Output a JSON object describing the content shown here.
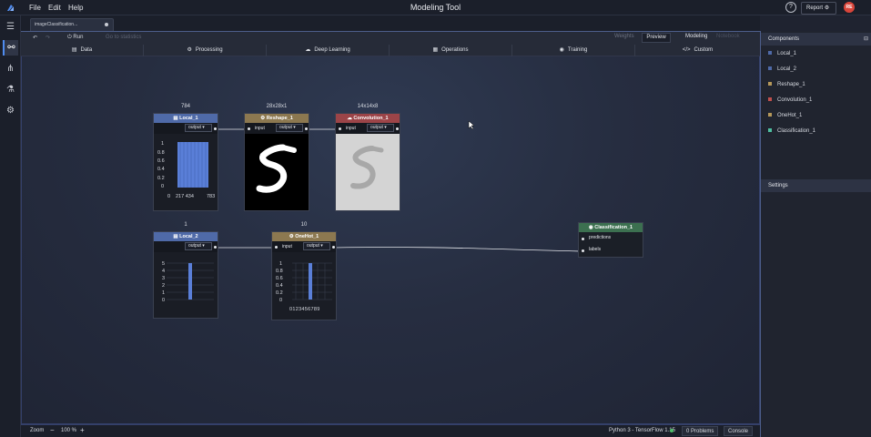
{
  "app": {
    "title": "Modeling Tool"
  },
  "menu": {
    "file": "File",
    "edit": "Edit",
    "help": "Help"
  },
  "header": {
    "help_label": "?",
    "report_label": "Report",
    "avatar_initials": "RE"
  },
  "tab": {
    "name": "imageClassification..."
  },
  "toolbar": {
    "run_label": "Run",
    "go_statistics": "Go to statistics",
    "weights": "Weights",
    "preview": "Preview",
    "modeling": "Modeling",
    "notebook": "Notebook"
  },
  "categories": [
    {
      "label": "Data",
      "icon": "database-icon",
      "color": "#7f8db0"
    },
    {
      "label": "Processing",
      "icon": "gear-icon",
      "color": "#b5985a"
    },
    {
      "label": "Deep Learning",
      "icon": "brain-icon",
      "color": "#b04b52"
    },
    {
      "label": "Operations",
      "icon": "grid-icon",
      "color": "#5a7fd8"
    },
    {
      "label": "Training",
      "icon": "target-icon",
      "color": "#5aa06b"
    },
    {
      "label": "Custom",
      "icon": "code-icon",
      "color": "#8c92a2"
    }
  ],
  "components": {
    "local1": {
      "name": "Local_1",
      "dim": "784",
      "port_out": "output",
      "axis": [
        "1",
        "0.8",
        "0.6",
        "0.4",
        "0.2",
        "0"
      ],
      "xticks": [
        "0",
        "217 434",
        "783"
      ],
      "color": "#4f6aa8"
    },
    "reshape1": {
      "name": "Reshape_1",
      "dim": "28x28x1",
      "port_in": "input",
      "port_out": "output",
      "color": "#8c7850"
    },
    "conv1": {
      "name": "Convolution_1",
      "dim": "14x14x8",
      "port_in": "input",
      "port_out": "output",
      "color": "#9c4448"
    },
    "local2": {
      "name": "Local_2",
      "dim": "1",
      "port_out": "output",
      "axis": [
        "5",
        "4",
        "3",
        "2",
        "1",
        "0"
      ],
      "color": "#4f6aa8",
      "value": 5
    },
    "onehot1": {
      "name": "OneHot_1",
      "dim": "10",
      "port_in": "input",
      "port_out": "output",
      "axis": [
        "1",
        "0.8",
        "0.6",
        "0.4",
        "0.2",
        "0"
      ],
      "xticks": "0123456789",
      "color": "#8c7850",
      "value_index": 5
    },
    "class1": {
      "name": "Classification_1",
      "port_pred": "predictions",
      "port_labels": "labels",
      "color": "#3c7050"
    }
  },
  "right_panel": {
    "components_title": "Components",
    "settings_title": "Settings",
    "items": [
      {
        "label": "Local_1",
        "color": "#4f6aa8"
      },
      {
        "label": "Local_2",
        "color": "#4f6aa8"
      },
      {
        "label": "Reshape_1",
        "color": "#b5985a"
      },
      {
        "label": "Convolution_1",
        "color": "#c0504d"
      },
      {
        "label": "OneHot_1",
        "color": "#b5985a"
      },
      {
        "label": "Classification_1",
        "color": "#4fbfa0"
      }
    ]
  },
  "status": {
    "zoom_label": "Zoom",
    "zoom_value": "100 %",
    "runtime": "Python 3 - TensorFlow 1.15",
    "problems": "0 Problems",
    "console": "Console"
  }
}
